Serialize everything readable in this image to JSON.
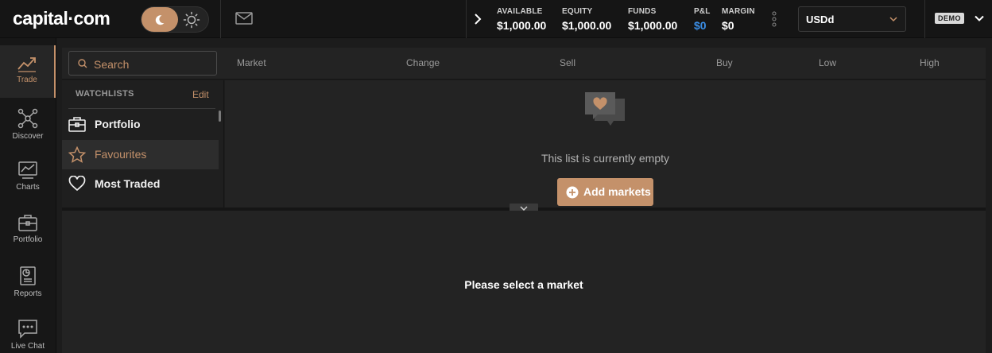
{
  "brand": {
    "logo_text": "capital·com"
  },
  "account": {
    "available_label": "AVAILABLE",
    "available_value": "$1,000.00",
    "equity_label": "EQUITY",
    "equity_value": "$1,000.00",
    "funds_label": "FUNDS",
    "funds_value": "$1,000.00",
    "pnl_label": "P&L",
    "pnl_value": "$0",
    "margin_label": "MARGIN",
    "margin_value": "$0",
    "currency": "USDd",
    "mode_badge": "DEMO"
  },
  "nav": [
    {
      "label": "Trade",
      "icon": "trending-up-icon"
    },
    {
      "label": "Discover",
      "icon": "network-icon"
    },
    {
      "label": "Charts",
      "icon": "chart-icon"
    },
    {
      "label": "Portfolio",
      "icon": "briefcase-icon"
    },
    {
      "label": "Reports",
      "icon": "report-icon"
    },
    {
      "label": "Live Chat",
      "icon": "chat-icon"
    }
  ],
  "search": {
    "placeholder": "Search"
  },
  "columns": [
    "Market",
    "Change",
    "Sell",
    "Buy",
    "Low",
    "High"
  ],
  "watchlists": {
    "title": "WATCHLISTS",
    "edit": "Edit",
    "items": [
      {
        "label": "Portfolio",
        "icon": "briefcase-icon"
      },
      {
        "label": "Favourites",
        "icon": "star-icon"
      },
      {
        "label": "Most Traded",
        "icon": "heart-icon"
      }
    ],
    "selected": "Favourites"
  },
  "empty_state": {
    "message": "This list is currently empty",
    "button": "Add markets"
  },
  "details": {
    "message": "Please select a market"
  },
  "colors": {
    "accent": "#c4916a",
    "pnl": "#3b8fe8",
    "background": "#1c1c1c"
  }
}
